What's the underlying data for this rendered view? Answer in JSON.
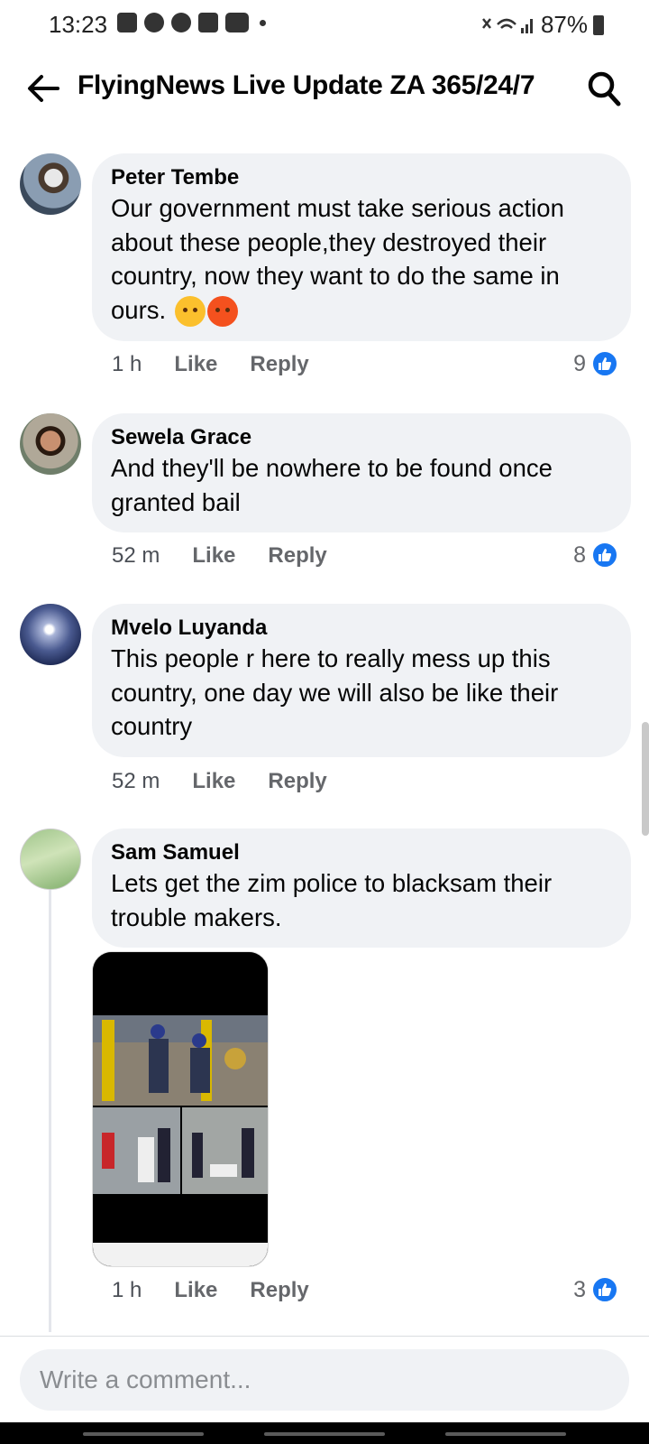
{
  "status_bar": {
    "time": "13:23",
    "battery": "87%",
    "notification_icons": [
      "message-icon",
      "facebook-icon",
      "facebook-icon",
      "download-icon",
      "youtube-icon"
    ],
    "system_icons": [
      "mute-icon",
      "wifi-icon",
      "signal-icon",
      "battery-icon"
    ]
  },
  "header": {
    "title": "FlyingNews Live Update ZA 365/24/7"
  },
  "comments": [
    {
      "author": "Peter Tembe",
      "text": "Our government must take serious action about these people,they destroyed their country, now they want to do the same in ours.",
      "emojis": [
        "annoyed-face",
        "angry-face"
      ],
      "time": "1 h",
      "like_label": "Like",
      "reply_label": "Reply",
      "reaction_count": "9"
    },
    {
      "author": "Sewela Grace",
      "text": "And they'll be nowhere to be found once granted bail",
      "time": "52 m",
      "like_label": "Like",
      "reply_label": "Reply",
      "reaction_count": "8"
    },
    {
      "author": "Mvelo Luyanda",
      "text": "This people r here to really mess up this country, one day we will also be like their country",
      "time": "52 m",
      "like_label": "Like",
      "reply_label": "Reply"
    },
    {
      "author": "Sam Samuel",
      "text": "Lets get the zim police to blacksam their trouble makers.",
      "time": "1 h",
      "like_label": "Like",
      "reply_label": "Reply",
      "reaction_count": "3"
    }
  ],
  "composer": {
    "placeholder": "Write a comment..."
  },
  "colors": {
    "bubble": "#f0f2f5",
    "like_blue": "#1877f2",
    "meta_gray": "#65676b"
  }
}
